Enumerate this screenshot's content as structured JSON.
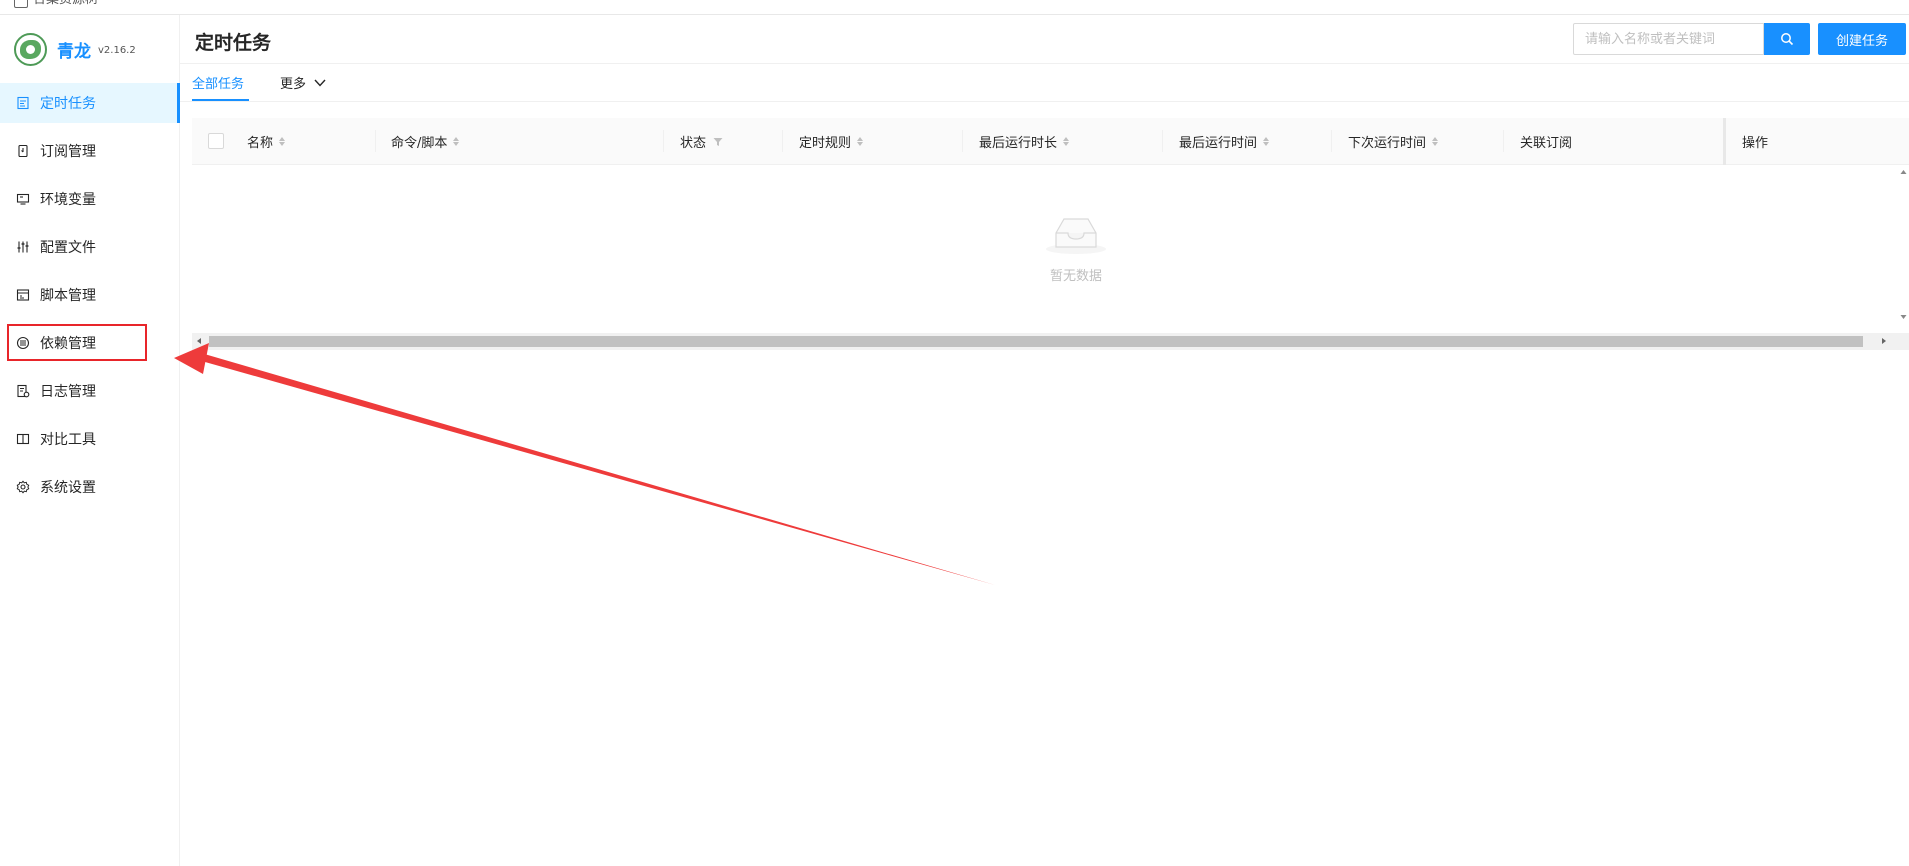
{
  "topstrip": {
    "text": "合集资源树"
  },
  "brand": {
    "name": "青龙",
    "version": "v2.16.2"
  },
  "sidebar": {
    "items": [
      {
        "label": "定时任务",
        "icon": "calendar-icon",
        "active": true
      },
      {
        "label": "订阅管理",
        "icon": "subscription-icon",
        "active": false
      },
      {
        "label": "环境变量",
        "icon": "monitor-icon",
        "active": false
      },
      {
        "label": "配置文件",
        "icon": "sliders-icon",
        "active": false
      },
      {
        "label": "脚本管理",
        "icon": "code-window-icon",
        "active": false
      },
      {
        "label": "依赖管理",
        "icon": "database-icon",
        "active": false
      },
      {
        "label": "日志管理",
        "icon": "log-file-icon",
        "active": false
      },
      {
        "label": "对比工具",
        "icon": "book-icon",
        "active": false
      },
      {
        "label": "系统设置",
        "icon": "gear-icon",
        "active": false
      }
    ]
  },
  "header": {
    "title": "定时任务",
    "search_placeholder": "请输入名称或者关键词",
    "create_label": "创建任务"
  },
  "tabs": {
    "all_label": "全部任务",
    "more_label": "更多"
  },
  "table": {
    "columns": [
      "名称",
      "命令/脚本",
      "状态",
      "定时规则",
      "最后运行时长",
      "最后运行时间",
      "下次运行时间",
      "关联订阅",
      "操作"
    ],
    "rows": [],
    "empty_text": "暂无数据"
  },
  "colors": {
    "accent": "#1890ff",
    "highlight": "#e8252a",
    "brand_green": "#5aa860"
  }
}
